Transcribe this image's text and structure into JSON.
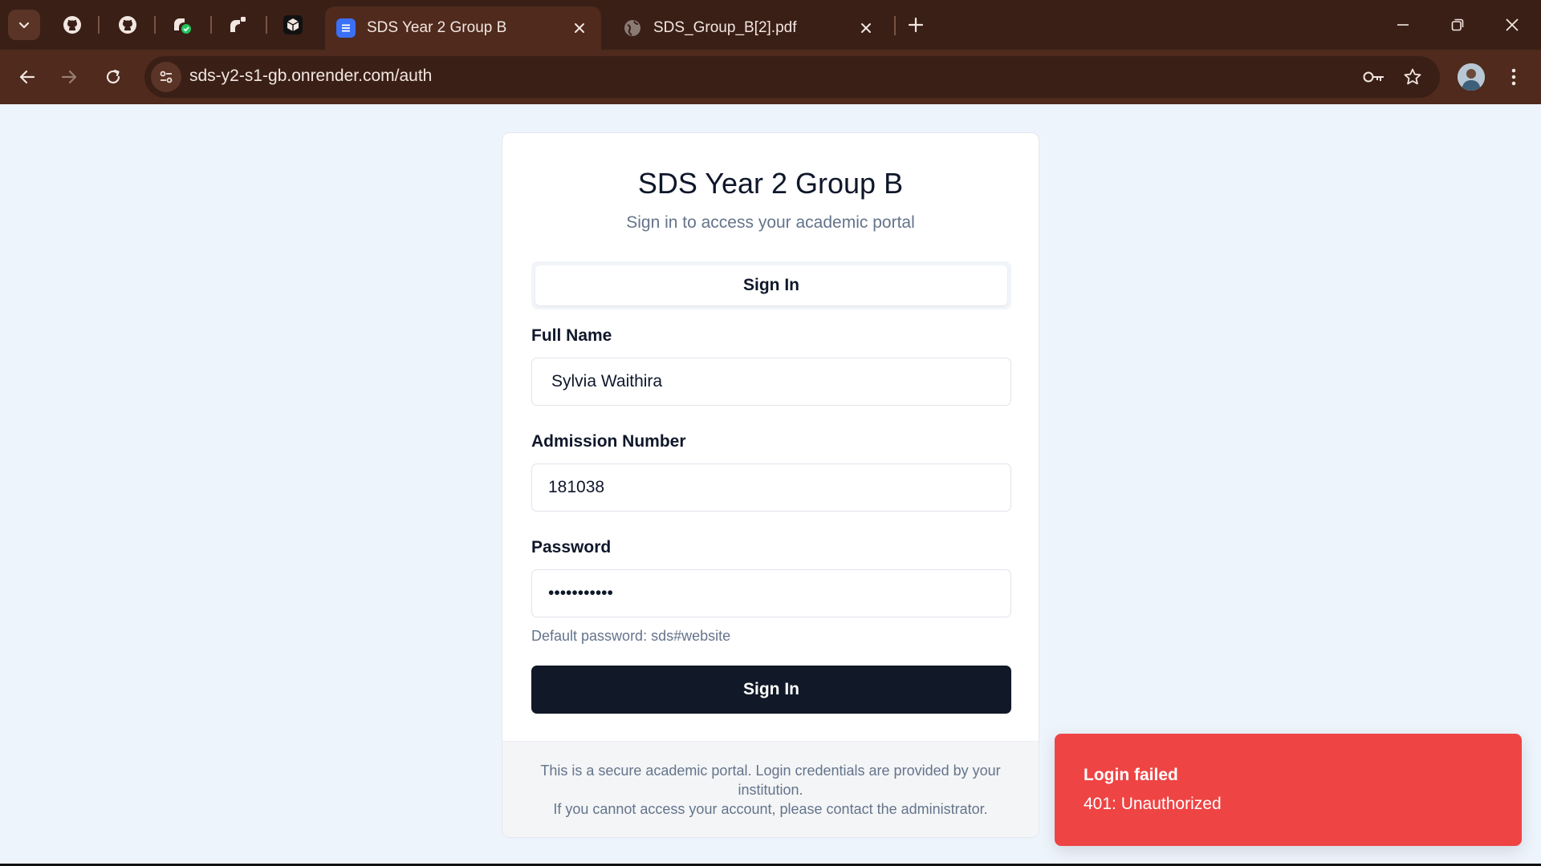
{
  "browser": {
    "tabs": [
      {
        "title": "SDS Year 2 Group B",
        "active": true
      },
      {
        "title": "SDS_Group_B[2].pdf",
        "active": false
      }
    ],
    "url": "sds-y2-s1-gb.onrender.com/auth"
  },
  "card": {
    "title": "SDS Year 2 Group B",
    "subtitle": "Sign in to access your academic portal",
    "tab_label": "Sign In",
    "full_name_label": "Full Name",
    "full_name_value": "Sylvia Waithira",
    "admission_label": "Admission Number",
    "admission_value": "181038",
    "password_label": "Password",
    "password_value": "•••••••••••",
    "password_hint": "Default password: sds#website",
    "submit_label": "Sign In",
    "footer_line1": "This is a secure academic portal. Login credentials are provided by your institution.",
    "footer_line2": "If you cannot access your account, please contact the administrator."
  },
  "toast": {
    "title": "Login failed",
    "description": "401: Unauthorized"
  },
  "colors": {
    "page_bg": "#eef4fc",
    "chrome_dark": "#3a1f16",
    "chrome_toolbar": "#4f2a1d",
    "primary_button": "#111827",
    "toast_bg": "#ef4444"
  }
}
